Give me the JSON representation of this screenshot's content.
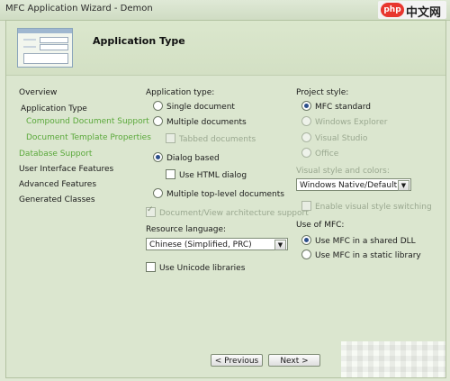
{
  "window": {
    "title": "MFC Application Wizard - Demon"
  },
  "watermark": {
    "badge": "php",
    "text": "中文网"
  },
  "header": {
    "title": "Application Type"
  },
  "nav": {
    "items": [
      {
        "label": "Overview"
      },
      {
        "label": "Application Type"
      },
      {
        "label": "Compound Document Support"
      },
      {
        "label": "Document Template Properties"
      },
      {
        "label": "Database Support"
      },
      {
        "label": "User Interface Features"
      },
      {
        "label": "Advanced Features"
      },
      {
        "label": "Generated Classes"
      }
    ]
  },
  "app_type": {
    "label": "Application type:",
    "options": [
      {
        "label": "Single document",
        "selected": false
      },
      {
        "label": "Multiple documents",
        "selected": false
      },
      {
        "label": "Tabbed documents",
        "checked": false,
        "disabled": true
      },
      {
        "label": "Dialog based",
        "selected": true
      },
      {
        "label": "Use HTML dialog",
        "checked": false
      },
      {
        "label": "Multiple top-level documents",
        "selected": false
      },
      {
        "label": "Document/View architecture support",
        "checked": true,
        "disabled": true
      }
    ]
  },
  "resource_language": {
    "label": "Resource language:",
    "value": "Chinese (Simplified, PRC)"
  },
  "unicode": {
    "label": "Use Unicode libraries",
    "checked": false
  },
  "project_style": {
    "label": "Project style:",
    "options": [
      {
        "label": "MFC standard",
        "selected": true,
        "disabled": false
      },
      {
        "label": "Windows Explorer",
        "selected": false,
        "disabled": true
      },
      {
        "label": "Visual Studio",
        "selected": false,
        "disabled": true
      },
      {
        "label": "Office",
        "selected": false,
        "disabled": true
      }
    ]
  },
  "visual_style": {
    "label": "Visual style and colors:",
    "value": "Windows Native/Default",
    "switching_label": "Enable visual style switching"
  },
  "use_mfc": {
    "label": "Use of MFC:",
    "options": [
      {
        "label": "Use MFC in a shared DLL",
        "selected": true
      },
      {
        "label": "Use MFC in a static library",
        "selected": false
      }
    ]
  },
  "footer": {
    "previous": "< Previous",
    "next": "Next >"
  },
  "colors": {
    "accent_link": "#5aa83a",
    "background": "#dbe6cf"
  }
}
